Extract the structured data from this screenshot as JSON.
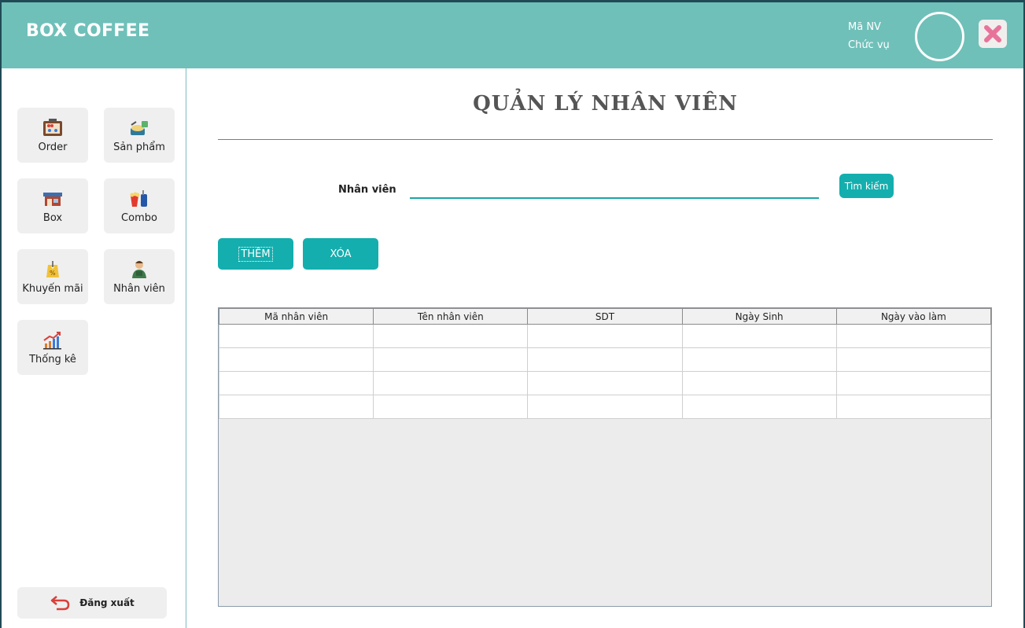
{
  "app": {
    "title": "BOX COFFEE"
  },
  "user": {
    "id_label": "Mã NV",
    "role_label": "Chức vụ"
  },
  "sidebar": {
    "items": [
      {
        "label": "Order",
        "icon": "abacus-icon"
      },
      {
        "label": "Sản phẩm",
        "icon": "food-tray-icon"
      },
      {
        "label": "Box",
        "icon": "store-box-icon"
      },
      {
        "label": "Combo",
        "icon": "popcorn-drink-icon"
      },
      {
        "label": "Khuyến mãi",
        "icon": "discount-tag-icon"
      },
      {
        "label": "Nhân viên",
        "icon": "employee-icon"
      },
      {
        "label": "Thống kê",
        "icon": "chart-growth-icon"
      }
    ],
    "logout_label": "Đăng xuất"
  },
  "main": {
    "title": "QUẢN LÝ NHÂN VIÊN",
    "search": {
      "label": "Nhân viên",
      "value": "",
      "button": "Tìm kiếm"
    },
    "actions": {
      "add": "THÊM",
      "delete": "XÓA"
    },
    "table": {
      "columns": [
        "Mã nhân viên",
        "Tên nhân viên",
        "SDT",
        "Ngày Sinh",
        "Ngày vào làm"
      ],
      "rows": [
        [
          "",
          "",
          "",
          "",
          ""
        ],
        [
          "",
          "",
          "",
          "",
          ""
        ],
        [
          "",
          "",
          "",
          "",
          ""
        ],
        [
          "",
          "",
          "",
          "",
          ""
        ]
      ]
    }
  },
  "colors": {
    "header": "#6fc0b9",
    "accent": "#14aeae",
    "close_icon": "#e8739a"
  }
}
